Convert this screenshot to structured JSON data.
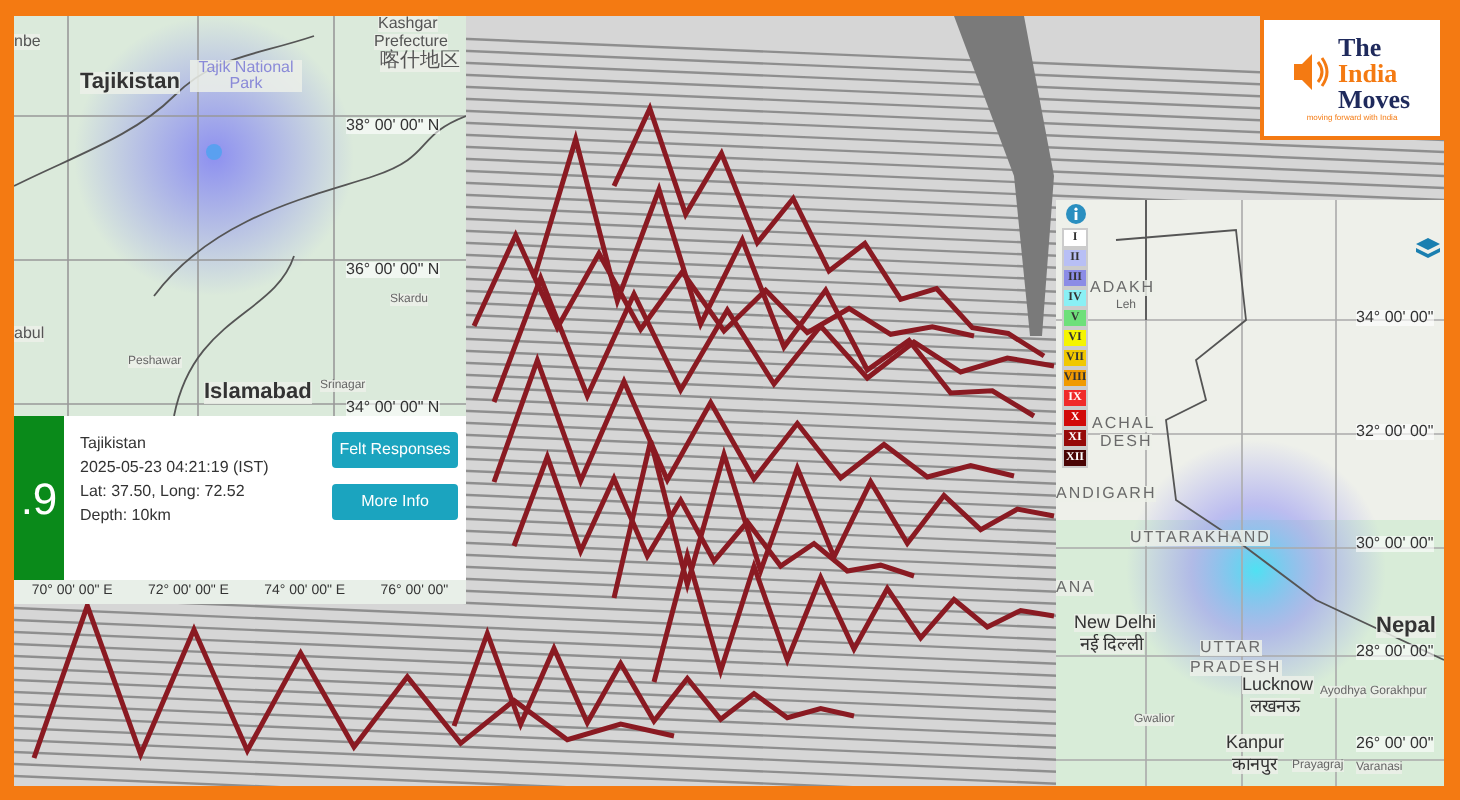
{
  "brand": {
    "lines": [
      "The",
      "India",
      "Moves"
    ],
    "tagline": "moving forward with India"
  },
  "left_map": {
    "labels": [
      {
        "text": "nbe",
        "kind": "place"
      },
      {
        "text": "Tajikistan",
        "kind": "country"
      },
      {
        "text": "Tajik National Park",
        "kind": "park"
      },
      {
        "text": "Kashgar",
        "kind": "place"
      },
      {
        "text": "Prefecture",
        "kind": "place"
      },
      {
        "text": "喀什地区",
        "kind": "native"
      },
      {
        "text": "38° 00' 00\" N",
        "kind": "grid"
      },
      {
        "text": "36° 00' 00\" N",
        "kind": "grid"
      },
      {
        "text": "Skardu",
        "kind": "small"
      },
      {
        "text": "abul",
        "kind": "place"
      },
      {
        "text": "Peshawar",
        "kind": "small"
      },
      {
        "text": "Islamabad",
        "kind": "country"
      },
      {
        "text": "Srinagar",
        "kind": "small"
      },
      {
        "text": "34° 00' 00\" N",
        "kind": "grid"
      }
    ],
    "event": {
      "magnitude": ".9",
      "color": "#0a8a1a",
      "region": "Tajikistan",
      "datetime": "2025-05-23 04:21:19 (IST)",
      "coords": "Lat: 37.50, Long: 72.52",
      "depth": "Depth: 10km"
    },
    "buttons": [
      "Felt Responses",
      "More Info"
    ],
    "x_axis": [
      "70° 00' 00\" E",
      "72° 00' 00\" E",
      "74° 00' 00\" E",
      "76° 00' 00\""
    ]
  },
  "right_map": {
    "legend": [
      {
        "label": "I",
        "color": "#ffffff"
      },
      {
        "label": "II",
        "color": "#b8bff5"
      },
      {
        "label": "III",
        "color": "#8c8ce6"
      },
      {
        "label": "IV",
        "color": "#8af0f5"
      },
      {
        "label": "V",
        "color": "#6ee07a"
      },
      {
        "label": "VI",
        "color": "#f5f500"
      },
      {
        "label": "VII",
        "color": "#f0c800"
      },
      {
        "label": "VIII",
        "color": "#f09a00"
      },
      {
        "label": "IX",
        "color": "#f02a2a"
      },
      {
        "label": "X",
        "color": "#d20a0a"
      },
      {
        "label": "XI",
        "color": "#960a0a"
      },
      {
        "label": "XII",
        "color": "#4a0505"
      }
    ],
    "labels": [
      {
        "text": "ADAKH",
        "kind": "region"
      },
      {
        "text": "Leh",
        "kind": "small"
      },
      {
        "text": "34° 00' 00\"",
        "kind": "grid"
      },
      {
        "text": "ACHAL",
        "kind": "region"
      },
      {
        "text": "DESH",
        "kind": "region"
      },
      {
        "text": "32° 00' 00\"",
        "kind": "grid"
      },
      {
        "text": "ANDIGARH",
        "kind": "region"
      },
      {
        "text": "UTTARAKHAND",
        "kind": "region"
      },
      {
        "text": "30° 00' 00\"",
        "kind": "grid"
      },
      {
        "text": "ANA",
        "kind": "region"
      },
      {
        "text": "New Delhi",
        "kind": "city"
      },
      {
        "text": "नई दिल्ली",
        "kind": "city"
      },
      {
        "text": "UTTAR",
        "kind": "region"
      },
      {
        "text": "PRADESH",
        "kind": "region"
      },
      {
        "text": "Nepal",
        "kind": "country"
      },
      {
        "text": "28° 00' 00\"",
        "kind": "grid"
      },
      {
        "text": "Lucknow",
        "kind": "city"
      },
      {
        "text": "लखनऊ",
        "kind": "city"
      },
      {
        "text": "Ayodhya",
        "kind": "small"
      },
      {
        "text": "Gorakhpur",
        "kind": "small"
      },
      {
        "text": "Gwalior",
        "kind": "small"
      },
      {
        "text": "Kanpur",
        "kind": "city"
      },
      {
        "text": "कानपुर",
        "kind": "city"
      },
      {
        "text": "26° 00' 00\"",
        "kind": "grid"
      },
      {
        "text": "Prayagraj",
        "kind": "small"
      },
      {
        "text": "Varanasi",
        "kind": "small"
      }
    ]
  }
}
